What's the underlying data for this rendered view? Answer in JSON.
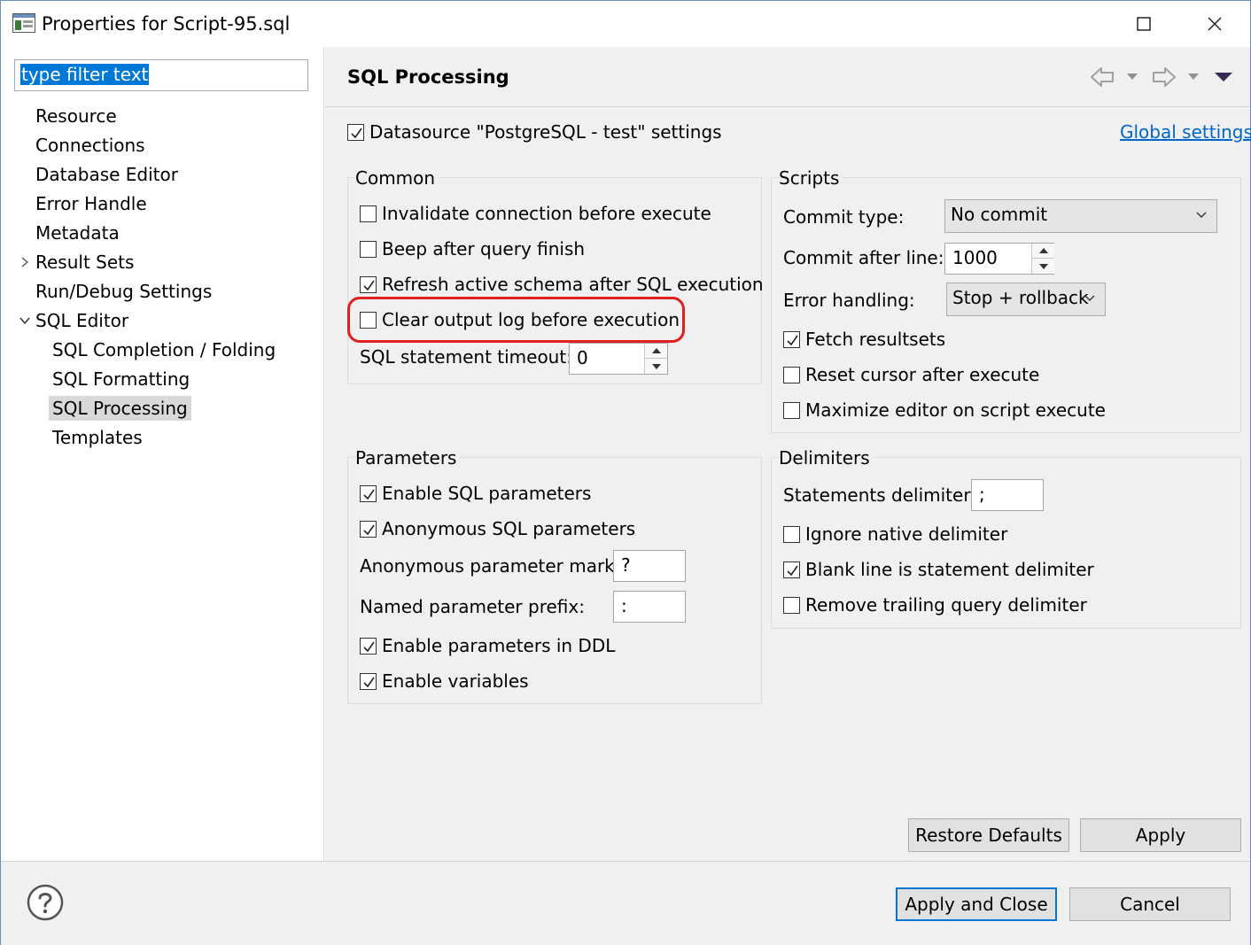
{
  "window": {
    "title": "Properties for Script-95.sql"
  },
  "filter": {
    "value": "type filter text"
  },
  "tree": {
    "items": [
      {
        "label": "Resource"
      },
      {
        "label": "Connections"
      },
      {
        "label": "Database Editor"
      },
      {
        "label": "Error Handle"
      },
      {
        "label": "Metadata"
      },
      {
        "label": "Result Sets"
      },
      {
        "label": "Run/Debug Settings"
      },
      {
        "label": "SQL Editor"
      },
      {
        "label": "SQL Completion / Folding"
      },
      {
        "label": "SQL Formatting"
      },
      {
        "label": "SQL Processing"
      },
      {
        "label": "Templates"
      }
    ]
  },
  "page": {
    "title": "SQL Processing",
    "datasource_label": "Datasource \"PostgreSQL - test\" settings",
    "global_settings": "Global settings"
  },
  "common": {
    "title": "Common",
    "invalidate": "Invalidate connection before execute",
    "beep": "Beep after query finish",
    "refresh": "Refresh active schema after SQL execution",
    "clear_log": "Clear output log before execution",
    "timeout_label": "SQL statement timeout:",
    "timeout_value": "0"
  },
  "scripts": {
    "title": "Scripts",
    "commit_type_label": "Commit type:",
    "commit_type_value": "No commit",
    "commit_after_label": "Commit after line:",
    "commit_after_value": "1000",
    "error_handling_label": "Error handling:",
    "error_handling_value": "Stop + rollback",
    "fetch": "Fetch resultsets",
    "reset_cursor": "Reset cursor after execute",
    "maximize": "Maximize editor on script execute"
  },
  "parameters": {
    "title": "Parameters",
    "enable_sql": "Enable SQL parameters",
    "anonymous_sql": "Anonymous SQL parameters",
    "anon_mark_label": "Anonymous parameter mark:",
    "anon_mark_value": "?",
    "named_prefix_label": "Named parameter prefix:",
    "named_prefix_value": ":",
    "enable_ddl": "Enable parameters in DDL",
    "enable_vars": "Enable variables"
  },
  "delimiters": {
    "title": "Delimiters",
    "stmt_delim_label": "Statements delimiter:",
    "stmt_delim_value": ";",
    "ignore_native": "Ignore native delimiter",
    "blank_line": "Blank line is statement delimiter",
    "remove_trailing": "Remove trailing query delimiter"
  },
  "buttons": {
    "restore": "Restore Defaults",
    "apply": "Apply",
    "apply_close": "Apply and Close",
    "cancel": "Cancel"
  },
  "colors": {
    "accent": "#0078d7",
    "link": "#0066cc",
    "highlight": "#e02020",
    "panel_bg": "#f0f0f0"
  }
}
